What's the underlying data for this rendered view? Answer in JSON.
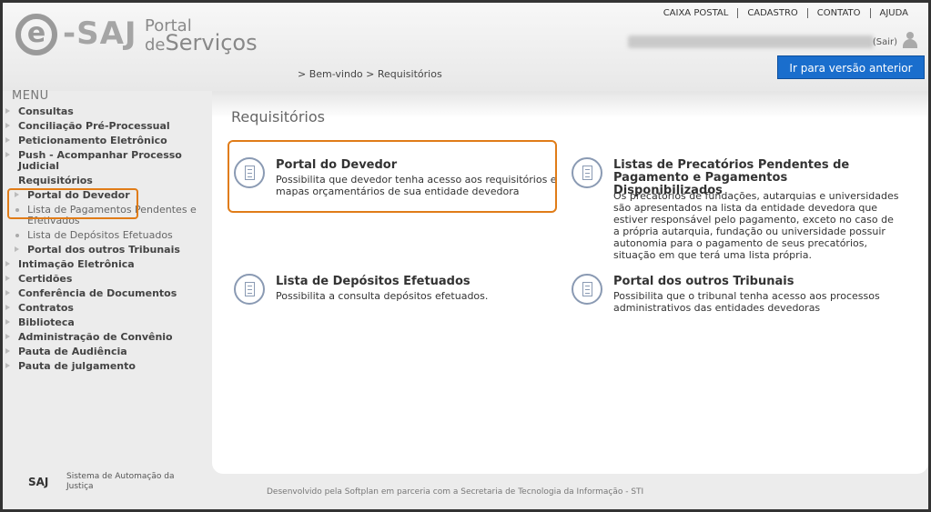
{
  "logo": {
    "e": "e",
    "saj": "-SAJ",
    "portal_line1": "Portal",
    "portal_de": "de",
    "portal_line2": "Serviços"
  },
  "toplinks": [
    "CAIXA POSTAL",
    "CADASTRO",
    "CONTATO",
    "AJUDA"
  ],
  "user": {
    "sair": "(Sair)"
  },
  "version_button": "Ir para versão anterior",
  "breadcrumb": "> Bem-vindo > Requisitórios",
  "menu": {
    "title": "MENU",
    "items": [
      {
        "label": "Consultas"
      },
      {
        "label": "Conciliação Pré-Processual"
      },
      {
        "label": "Peticionamento Eletrônico"
      },
      {
        "label": "Push - Acompanhar Processo Judicial"
      },
      {
        "label": "Requisitórios"
      }
    ],
    "sub": [
      {
        "label": "Portal do Devedor"
      },
      {
        "label": "Lista de Pagamentos Pendentes e Efetivados"
      },
      {
        "label": "Lista de Depósitos Efetuados"
      },
      {
        "label": "Portal dos outros Tribunais"
      }
    ],
    "items2": [
      {
        "label": "Intimação Eletrônica"
      },
      {
        "label": "Certidões"
      },
      {
        "label": "Conferência de Documentos"
      },
      {
        "label": "Contratos"
      },
      {
        "label": "Biblioteca"
      },
      {
        "label": "Administração de Convênio"
      },
      {
        "label": "Pauta de Audiência"
      },
      {
        "label": "Pauta de julgamento"
      }
    ]
  },
  "page_title": "Requisitórios",
  "cards": [
    {
      "title": "Portal do Devedor",
      "desc": "Possibilita que devedor tenha acesso aos requisitórios e mapas orçamentários de sua entidade devedora"
    },
    {
      "title": "Listas de Precatórios Pendentes de Pagamento e Pagamentos Disponibilizados",
      "desc": "Os precatórios de fundações, autarquias e universidades são apresentados na lista da entidade devedora que estiver responsável pelo pagamento, exceto no caso de a própria autarquia, fundação ou universidade possuir autonomia para o pagamento de seus precatórios, situação em que terá uma lista própria."
    },
    {
      "title": "Lista de Depósitos Efetuados",
      "desc": "Possibilita a consulta depósitos efetuados."
    },
    {
      "title": "Portal dos outros Tribunais",
      "desc": "Possibilita que o tribunal tenha acesso aos processos administrativos das entidades devedoras"
    }
  ],
  "footer": {
    "saj": "SAJ",
    "system": "Sistema de Automação da Justiça",
    "credits": "Desenvolvido pela Softplan em parceria com a Secretaria de Tecnologia da Informação - STI"
  }
}
